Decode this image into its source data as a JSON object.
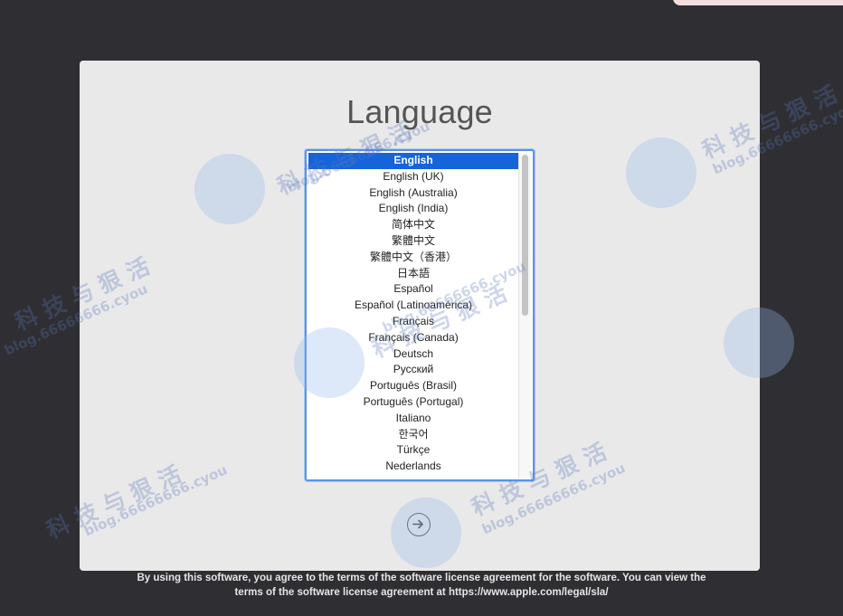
{
  "window": {
    "title": "Language"
  },
  "languages": [
    "English",
    "English (UK)",
    "English (Australia)",
    "English (India)",
    "简体中文",
    "繁體中文",
    "繁體中文（香港）",
    "日本語",
    "Español",
    "Español (Latinoamérica)",
    "Français",
    "Français (Canada)",
    "Deutsch",
    "Русский",
    "Português (Brasil)",
    "Português (Portugal)",
    "Italiano",
    "한국어",
    "Türkçe",
    "Nederlands"
  ],
  "selected_language": "English",
  "next_button_icon": "arrow-right-circle-icon",
  "footer": {
    "line1": "By using this software, you agree to the terms of the software license agreement for the software. You can view the",
    "line2": "terms of the software license agreement at https://www.apple.com/legal/sla/"
  },
  "watermark": {
    "cn": "科 技 与 狠 活",
    "url": "blog.66666666.cyou"
  },
  "colors": {
    "background": "#2f2f33",
    "panel": "#e9e9e9",
    "selection": "#1564da",
    "focus_ring": "#5b93e8"
  }
}
